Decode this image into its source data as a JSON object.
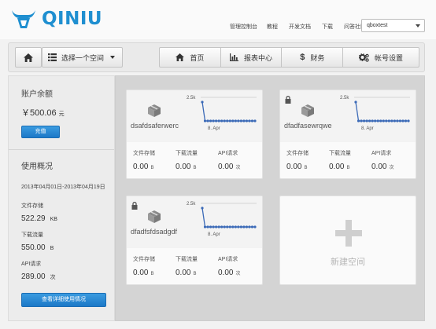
{
  "header": {
    "logo_text": "QINIU",
    "brand_color": "#1f8fd0",
    "nav": [
      "管理控制台",
      "教程",
      "开发文档",
      "下载",
      "问答社区"
    ],
    "user_selected": "qboxtest"
  },
  "toolbar": {
    "home_icon": "home-icon",
    "space_select_label": "选择一个空间",
    "tabs": [
      {
        "label": "首页",
        "icon": "home-icon"
      },
      {
        "label": "报表中心",
        "icon": "bar-chart-icon"
      },
      {
        "label": "财务",
        "icon": "dollar-icon"
      },
      {
        "label": "帐号设置",
        "icon": "gears-icon"
      }
    ]
  },
  "sidebar": {
    "balance_title": "账户余额",
    "balance_value": "￥500.06",
    "balance_unit": "元",
    "charge_button": "充值",
    "usage_title": "使用概况",
    "date_range": "2013年04月01日-2013年04月19日",
    "storage_label": "文件存储",
    "storage_value": "522.29",
    "storage_unit": "KB",
    "traffic_label": "下载流量",
    "traffic_value": "550.00",
    "traffic_unit": "B",
    "api_label": "API请求",
    "api_value": "289.00",
    "api_unit": "次",
    "detail_button": "查看详细使用情况"
  },
  "buckets": [
    {
      "name": "dsafdsaferwerc",
      "locked": false,
      "chart_y_tick": "2.5k",
      "chart_x_tick": "8. Apr",
      "storage_label": "文件存储",
      "storage_value": "0.00",
      "storage_unit": "B",
      "traffic_label": "下载流量",
      "traffic_value": "0.00",
      "traffic_unit": "B",
      "api_label": "API请求",
      "api_value": "0.00",
      "api_unit": "次"
    },
    {
      "name": "dfadfasewrqwe",
      "locked": true,
      "chart_y_tick": "2.5k",
      "chart_x_tick": "8. Apr",
      "storage_label": "文件存储",
      "storage_value": "0.00",
      "storage_unit": "B",
      "traffic_label": "下载流量",
      "traffic_value": "0.00",
      "traffic_unit": "B",
      "api_label": "API请求",
      "api_value": "0.00",
      "api_unit": "次"
    },
    {
      "name": "dfadfsfdsadgdf",
      "locked": true,
      "chart_y_tick": "2.5k",
      "chart_x_tick": "8. Apr",
      "storage_label": "文件存储",
      "storage_value": "0.00",
      "storage_unit": "B",
      "traffic_label": "下载流量",
      "traffic_value": "0.00",
      "traffic_unit": "B",
      "api_label": "API请求",
      "api_value": "0.00",
      "api_unit": "次"
    }
  ],
  "new_bucket_label": "新建空间",
  "series_color": "#3b6ab7"
}
